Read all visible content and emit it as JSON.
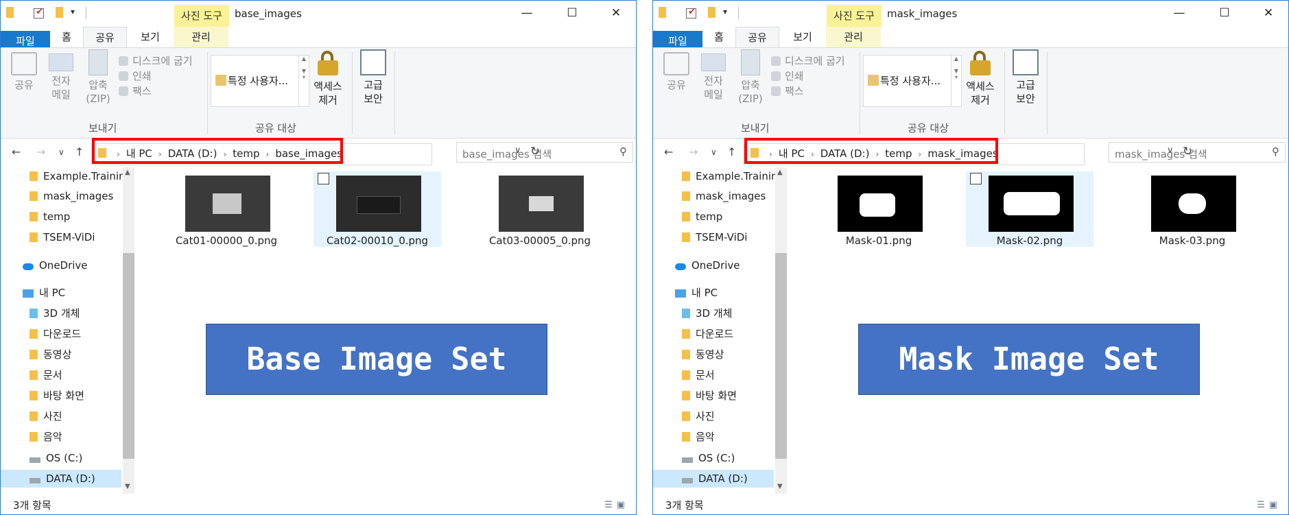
{
  "windows": [
    {
      "id": "left",
      "tool_tab": "사진 도구",
      "title": "base_images",
      "tabs": [
        "파일",
        "홈",
        "공유",
        "보기",
        "관리"
      ],
      "ribbon": {
        "share": "공유",
        "email": [
          "전자",
          "메일"
        ],
        "zip": [
          "압축",
          "(ZIP)"
        ],
        "burn": "디스크에 굽기",
        "print": "인쇄",
        "fax": "팩스",
        "send_group": "보내기",
        "share_with_item": "특정 사용자...",
        "share_with_group": "공유 대상",
        "remove_access": [
          "액세스",
          "제거"
        ],
        "advanced": [
          "고급",
          "보안"
        ]
      },
      "breadcrumb": [
        "내 PC",
        "DATA (D:)",
        "temp",
        "base_images"
      ],
      "search_placeholder": "base_images 검색",
      "sidebar": [
        "Example.Training",
        "mask_images",
        "temp",
        "TSEM-ViDi",
        "OneDrive",
        "내 PC",
        "3D 개체",
        "다운로드",
        "동영상",
        "문서",
        "바탕 화면",
        "사진",
        "음악",
        "OS (C:)",
        "DATA (D:)"
      ],
      "files": [
        "Cat01-00000_0.png",
        "Cat02-00010_0.png",
        "Cat03-00005_0.png"
      ],
      "banner": "Base Image Set",
      "status": "3개 항목"
    },
    {
      "id": "right",
      "tool_tab": "사진 도구",
      "title": "mask_images",
      "tabs": [
        "파일",
        "홈",
        "공유",
        "보기",
        "관리"
      ],
      "ribbon": {
        "share": "공유",
        "email": [
          "전자",
          "메일"
        ],
        "zip": [
          "압축",
          "(ZIP)"
        ],
        "burn": "디스크에 굽기",
        "print": "인쇄",
        "fax": "팩스",
        "send_group": "보내기",
        "share_with_item": "특정 사용자...",
        "share_with_group": "공유 대상",
        "remove_access": [
          "액세스",
          "제거"
        ],
        "advanced": [
          "고급",
          "보안"
        ]
      },
      "breadcrumb": [
        "내 PC",
        "DATA (D:)",
        "temp",
        "mask_images"
      ],
      "search_placeholder": "mask_images 검색",
      "sidebar": [
        "Example.Training",
        "mask_images",
        "temp",
        "TSEM-ViDi",
        "OneDrive",
        "내 PC",
        "3D 개체",
        "다운로드",
        "동영상",
        "문서",
        "바탕 화면",
        "사진",
        "음악",
        "OS (C:)",
        "DATA (D:)"
      ],
      "files": [
        "Mask-01.png",
        "Mask-02.png",
        "Mask-03.png"
      ],
      "banner": "Mask Image Set",
      "status": "3개 항목"
    }
  ],
  "colors": {
    "accent": "#1979ca",
    "highlight_box": "#ff0000",
    "banner": "#4472c4",
    "tool_tab": "#faf297"
  }
}
